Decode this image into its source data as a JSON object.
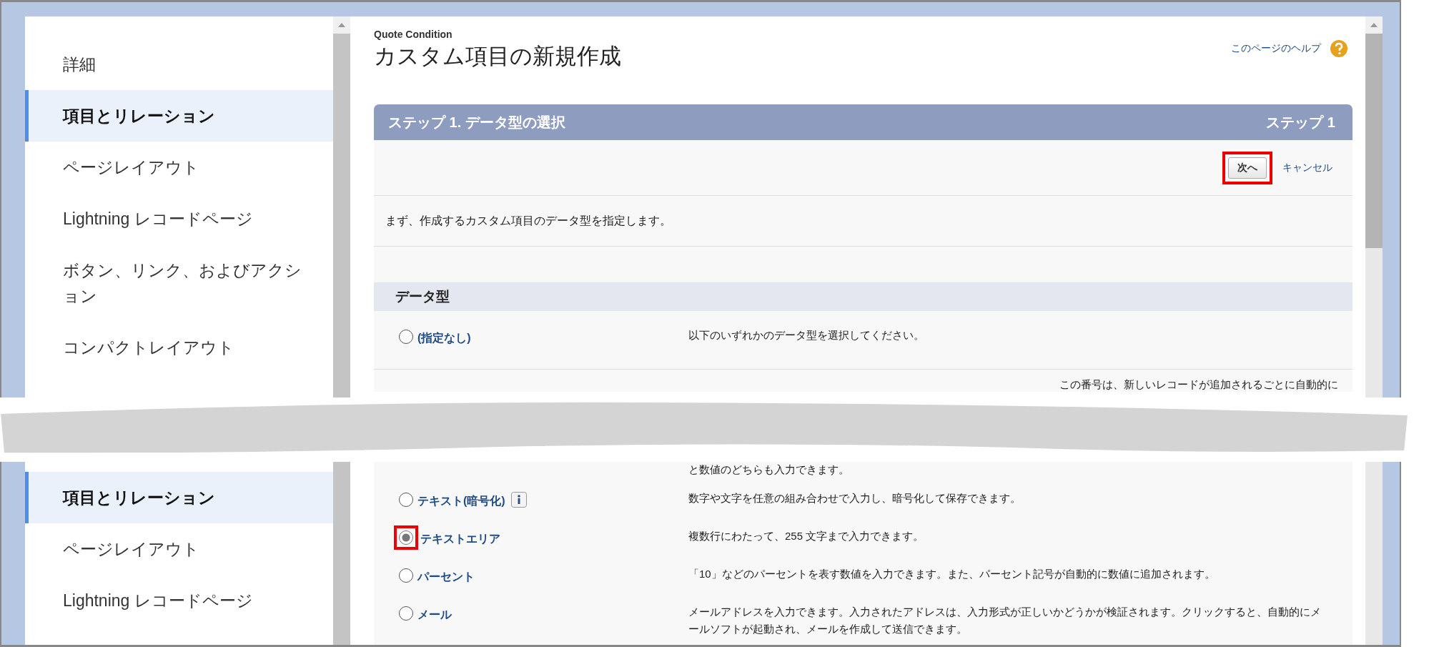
{
  "top": {
    "sidebar": {
      "items": [
        {
          "label": "詳細",
          "selected": false
        },
        {
          "label": "項目とリレーション",
          "selected": true
        },
        {
          "label": "ページレイアウト",
          "selected": false
        },
        {
          "label": "Lightning レコードページ",
          "selected": false
        },
        {
          "label": "ボタン、リンク、およびアクション",
          "selected": false
        },
        {
          "label": "コンパクトレイアウト",
          "selected": false
        }
      ]
    },
    "header": {
      "object_label": "Quote Condition",
      "title": "カスタム項目の新規作成",
      "help_link": "このページのヘルプ"
    },
    "step_panel": {
      "title": "ステップ 1. データ型の選択",
      "step": "ステップ 1",
      "buttons": [
        {
          "label": "次へ",
          "kind": "button",
          "highlighted": true
        },
        {
          "label": "キャンセル",
          "kind": "link",
          "highlighted": false
        }
      ],
      "instructions": "まず、作成するカスタム項目のデータ型を指定します。",
      "section_title": "データ型",
      "data_types": [
        {
          "label": "(指定なし)",
          "description": "以下のいずれかのデータ型を選択してください。",
          "selected": false,
          "highlighted": false,
          "info": false
        }
      ],
      "partial_description": "この番号は、新しいレコードが追加されるごとに自動的に"
    }
  },
  "bottom": {
    "sidebar": {
      "items": [
        {
          "label": "項目とリレーション",
          "selected": true
        },
        {
          "label": "ページレイアウト",
          "selected": false
        },
        {
          "label": "Lightning レコードページ",
          "selected": false
        }
      ]
    },
    "partial_description": "と数値のどちらも入力できます。",
    "data_types": [
      {
        "label": "テキスト(暗号化)",
        "description": "数字や文字を任意の組み合わせで入力し、暗号化して保存できます。",
        "selected": false,
        "highlighted": false,
        "info": true
      },
      {
        "label": "テキストエリア",
        "description": "複数行にわたって、255 文字まで入力できます。",
        "selected": true,
        "highlighted": true,
        "info": false
      },
      {
        "label": "パーセント",
        "description": "「10」などのパーセントを表す数値を入力できます。また、パーセント記号が自動的に数値に追加されます。",
        "selected": false,
        "highlighted": false,
        "info": false
      },
      {
        "label": "メール",
        "description": "メールアドレスを入力できます。入力されたアドレスは、入力形式が正しいかどうかが検証されます。クリックすると、自動的にメールソフトが起動され、メールを作成して送信できます。",
        "selected": false,
        "highlighted": false,
        "info": false
      }
    ]
  }
}
